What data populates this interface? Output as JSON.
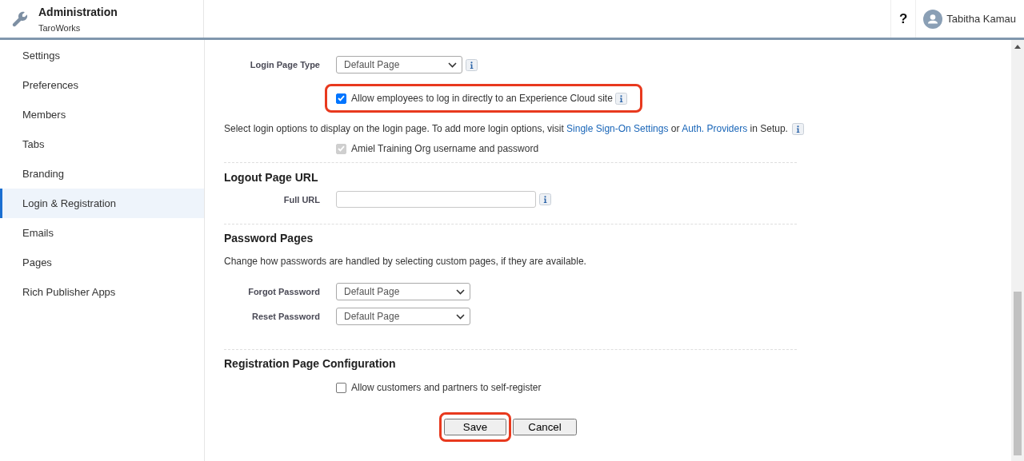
{
  "header": {
    "title": "Administration",
    "subtitle": "TaroWorks",
    "help": "?",
    "user": "Tabitha Kamau"
  },
  "sidebar": {
    "items": [
      {
        "label": "Settings",
        "selected": false
      },
      {
        "label": "Preferences",
        "selected": false
      },
      {
        "label": "Members",
        "selected": false
      },
      {
        "label": "Tabs",
        "selected": false
      },
      {
        "label": "Branding",
        "selected": false
      },
      {
        "label": "Login & Registration",
        "selected": true
      },
      {
        "label": "Emails",
        "selected": false
      },
      {
        "label": "Pages",
        "selected": false
      },
      {
        "label": "Rich Publisher Apps",
        "selected": false
      }
    ]
  },
  "login": {
    "page_type": {
      "label": "Login Page Type",
      "value": "Default Page"
    },
    "employee_login": {
      "label": "Allow employees to log in directly to an Experience Cloud site",
      "checked": true,
      "highlighted": true
    },
    "options_text": [
      {
        "kind": "text",
        "text": "Select login options to display on the login page. To add more login options, visit "
      },
      {
        "kind": "link",
        "text": "Single Sign-On Settings"
      },
      {
        "kind": "text",
        "text": " or "
      },
      {
        "kind": "link",
        "text": "Auth. Providers"
      },
      {
        "kind": "text",
        "text": " in Setup."
      }
    ],
    "options": [
      {
        "label": "Amiel Training Org username and password",
        "checked": true,
        "disabled": true
      }
    ]
  },
  "logout": {
    "heading": "Logout Page URL",
    "field": {
      "label": "Full URL"
    }
  },
  "password": {
    "heading": "Password Pages",
    "description": "Change how passwords are handled by selecting custom pages, if they are available.",
    "fields": [
      {
        "label": "Forgot Password",
        "value": "Default Page"
      },
      {
        "label": "Reset Password",
        "value": "Default Page"
      }
    ]
  },
  "registration": {
    "heading": "Registration Page Configuration",
    "options": [
      {
        "label": "Allow customers and partners to self-register",
        "checked": false
      }
    ]
  },
  "buttons": [
    {
      "label": "Save",
      "highlighted": true
    },
    {
      "label": "Cancel",
      "highlighted": false
    }
  ]
}
